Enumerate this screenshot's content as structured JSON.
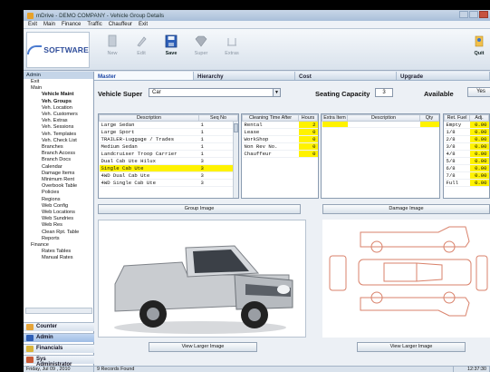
{
  "window": {
    "title": "mDrive - DEMO COMPANY - Vehicle Group Details"
  },
  "menu": [
    "Exit",
    "Main",
    "Finance",
    "Traffic",
    "Chauffeur",
    "Exit"
  ],
  "logo_text": "SOFTWARE",
  "toolbar": {
    "new": "New",
    "edit": "Edit",
    "save": "Save",
    "super": "Super",
    "extras": "Extras",
    "quit": "Quit"
  },
  "sidebar": {
    "header": "Admin",
    "tree": [
      {
        "label": "Exit",
        "level": 1
      },
      {
        "label": "Main",
        "level": 1
      },
      {
        "label": "Vehicle Maint",
        "level": 2,
        "bold": true
      },
      {
        "label": "Veh. Groups",
        "level": 2,
        "bold": true
      },
      {
        "label": "Veh. Location",
        "level": 2
      },
      {
        "label": "Veh. Customers",
        "level": 2
      },
      {
        "label": "Veh. Extras",
        "level": 2
      },
      {
        "label": "Veh. Sessions",
        "level": 2
      },
      {
        "label": "Veh. Templates",
        "level": 2
      },
      {
        "label": "Veh. Check List",
        "level": 2
      },
      {
        "label": "Branches",
        "level": 2
      },
      {
        "label": "Branch Access",
        "level": 2
      },
      {
        "label": "Branch Docs",
        "level": 2
      },
      {
        "label": "Calendar",
        "level": 2
      },
      {
        "label": "Damage Items",
        "level": 2
      },
      {
        "label": "Minimum Rent",
        "level": 2
      },
      {
        "label": "Overbook Table",
        "level": 2
      },
      {
        "label": "Policies",
        "level": 2
      },
      {
        "label": "Regions",
        "level": 2
      },
      {
        "label": "Web Config",
        "level": 2
      },
      {
        "label": "Web Locations",
        "level": 2
      },
      {
        "label": "Web Sundries",
        "level": 2
      },
      {
        "label": "Web Res",
        "level": 2
      },
      {
        "label": "Clean Rpt. Table",
        "level": 2
      },
      {
        "label": "Reports",
        "level": 2
      },
      {
        "label": "Finance",
        "level": 1
      },
      {
        "label": "Rates Tables",
        "level": 2
      },
      {
        "label": "Manual Rates",
        "level": 2
      }
    ],
    "nav": [
      "Counter",
      "Admin",
      "Financials",
      "Sys Administrator"
    ]
  },
  "tabs": [
    "Master",
    "Hierarchy",
    "Cost",
    "Upgrade"
  ],
  "vehicle_super": {
    "label": "Vehicle Super",
    "value": "Car"
  },
  "seating": {
    "label": "Seating Capacity",
    "value": "3"
  },
  "available": {
    "label": "Available",
    "value": "Yes"
  },
  "groups": {
    "headers": [
      "Description",
      "Seq No"
    ],
    "rows": [
      [
        "Large Sedan",
        "1"
      ],
      [
        "Large Sport",
        "1"
      ],
      [
        "TRAILER-Luggage / Trades",
        "1"
      ],
      [
        "Medium Sedan",
        "1"
      ],
      [
        "Landcruiser Troop Carrier",
        "1"
      ],
      [
        "Dual Cab Ute Hilux",
        "3"
      ],
      [
        "Single Cab Ute",
        "3"
      ],
      [
        "4WD Dual Cab Ute",
        "3"
      ],
      [
        "4WD Single Cab Ute",
        "3"
      ]
    ],
    "highlight": 6
  },
  "cleaning": {
    "headers": [
      "Cleaning Time After",
      "Hours"
    ],
    "rows": [
      [
        "Rental",
        "2"
      ],
      [
        "Lease",
        "0"
      ],
      [
        "WorkShop",
        "0"
      ],
      [
        "Non Rev No.",
        "0"
      ],
      [
        "Chauffeur",
        "0"
      ]
    ]
  },
  "extras": {
    "headers": [
      "Extra Item",
      "Description",
      "Qty"
    ]
  },
  "fuel": {
    "headers": [
      "Ret. Fuel",
      "Adj."
    ],
    "rows": [
      [
        "Empty",
        "0.00"
      ],
      [
        "1/8",
        "0.00"
      ],
      [
        "2/8",
        "0.00"
      ],
      [
        "3/8",
        "0.00"
      ],
      [
        "4/8",
        "0.00"
      ],
      [
        "5/8",
        "0.00"
      ],
      [
        "6/8",
        "0.00"
      ],
      [
        "7/8",
        "0.00"
      ],
      [
        "Full",
        "0.00"
      ]
    ]
  },
  "group_image_btn": "Group Image",
  "damage_image_btn": "Damage Image",
  "view_larger_left": "View Larger Image",
  "view_larger_right": "View Larger Image",
  "status": {
    "date": "Friday, Jul 09 , 2010",
    "records": "9 Records Found",
    "time": "12:37:30"
  }
}
